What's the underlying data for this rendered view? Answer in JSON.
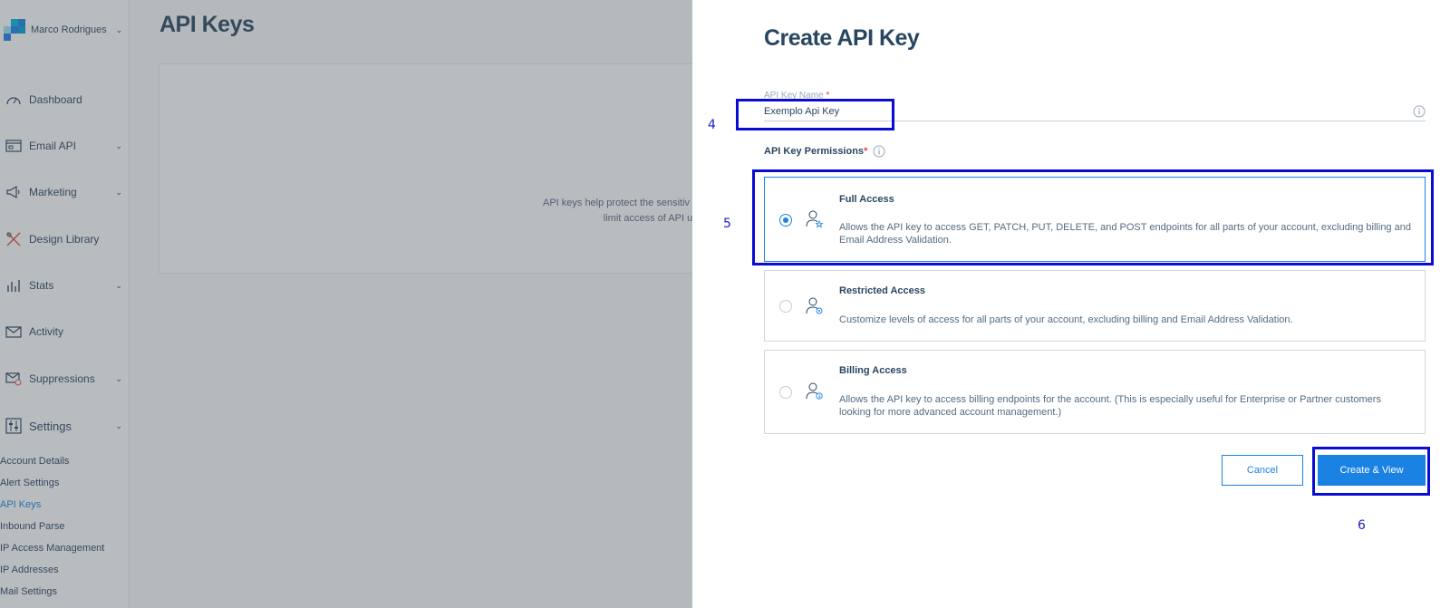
{
  "account": {
    "name": "Marco Rodrigues"
  },
  "sidebar": {
    "items": [
      {
        "label": "Dashboard",
        "icon": "gauge-icon",
        "has_children": false
      },
      {
        "label": "Email API",
        "icon": "email-window-icon",
        "has_children": true
      },
      {
        "label": "Marketing",
        "icon": "megaphone-icon",
        "has_children": true
      },
      {
        "label": "Design Library",
        "icon": "design-tools-icon",
        "has_children": false
      },
      {
        "label": "Stats",
        "icon": "bar-chart-icon",
        "has_children": true
      },
      {
        "label": "Activity",
        "icon": "envelope-activity-icon",
        "has_children": false
      },
      {
        "label": "Suppressions",
        "icon": "envelope-blocked-icon",
        "has_children": true
      },
      {
        "label": "Settings",
        "icon": "sliders-icon",
        "has_children": true,
        "expanded": true
      }
    ],
    "settings_items": [
      {
        "label": "Account Details",
        "active": false
      },
      {
        "label": "Alert Settings",
        "active": false
      },
      {
        "label": "API Keys",
        "active": true
      },
      {
        "label": "Inbound Parse",
        "active": false
      },
      {
        "label": "IP Access Management",
        "active": false
      },
      {
        "label": "IP Addresses",
        "active": false
      },
      {
        "label": "Mail Settings",
        "active": false
      }
    ]
  },
  "main": {
    "title": "API Keys",
    "empty_text_line1": "API keys help protect the sensitiv",
    "empty_text_line2": "limit access of API u"
  },
  "drawer": {
    "title": "Create API Key",
    "name_field": {
      "label": "API Key Name",
      "required_mark": "*",
      "value": "Exemplo Api Key"
    },
    "permissions_label": "API Key Permissions",
    "required_mark": "*",
    "options": [
      {
        "title": "Full Access",
        "description": "Allows the API key to access GET, PATCH, PUT, DELETE, and POST endpoints for all parts of your account, excluding billing and Email Address Validation.",
        "selected": true
      },
      {
        "title": "Restricted Access",
        "description": "Customize levels of access for all parts of your account, excluding billing and Email Address Validation.",
        "selected": false
      },
      {
        "title": "Billing Access",
        "description": "Allows the API key to access billing endpoints for the account. (This is especially useful for Enterprise or Partner customers looking for more advanced account management.)",
        "selected": false
      }
    ],
    "cancel_label": "Cancel",
    "create_label": "Create & View"
  },
  "annotations": [
    "4",
    "5",
    "6"
  ],
  "colors": {
    "primary": "#1a82e2",
    "text": "#294661",
    "annotation": "#0b0bd6",
    "required": "#e63b3b"
  }
}
